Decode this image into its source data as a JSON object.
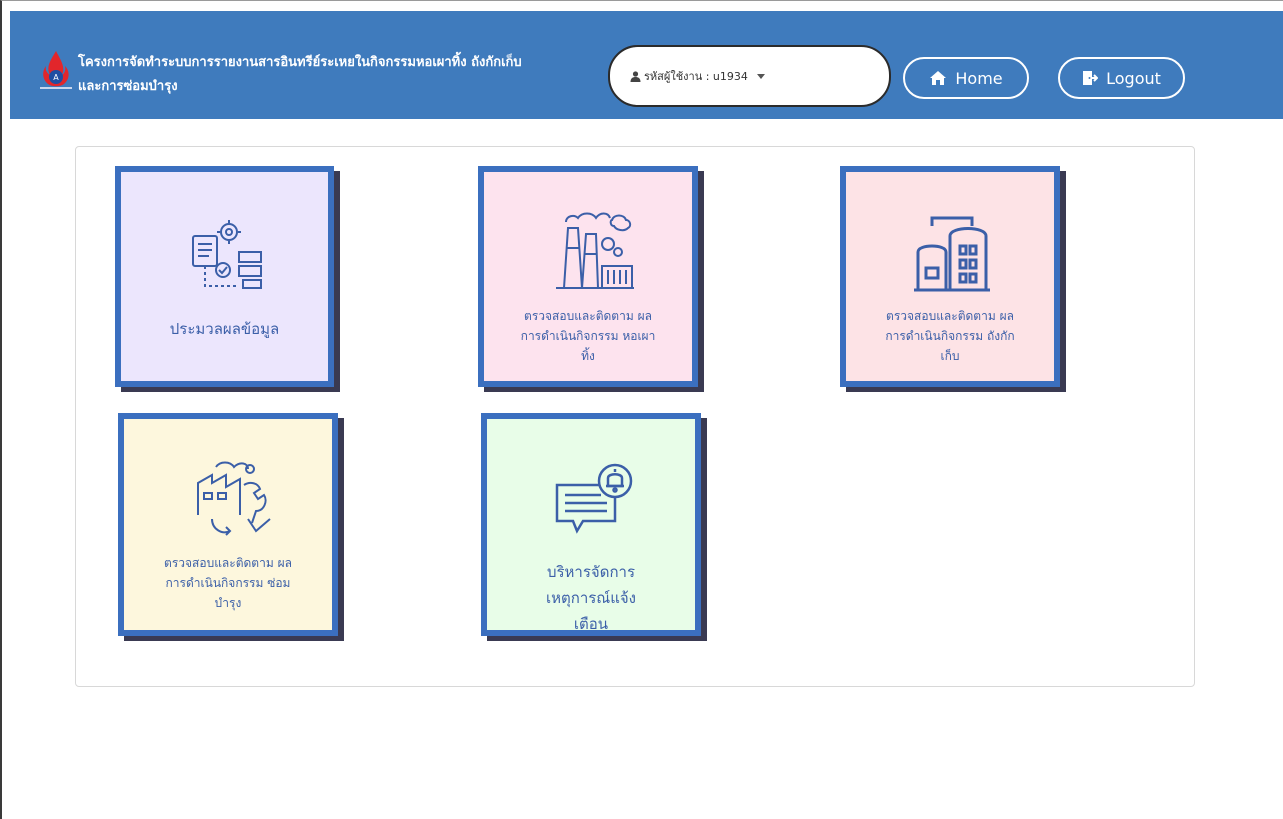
{
  "header": {
    "title": "โครงการจัดทำระบบการรายงานสารอินทรีย์ระเหยในกิจกรรมหอเผาทิ้ง ถังกักเก็บ และการซ่อมบำรุง",
    "logo_icon": "flame-logo-icon",
    "user_label": "รหัสผู้ใช้งาน : u1934",
    "home_label": "Home",
    "logout_label": "Logout",
    "bg_color": "#3f7bbd"
  },
  "cards": [
    {
      "label": "ประมวลผลข้อมูล",
      "icon": "data-process-gear-icon",
      "bg": "#ece6fd"
    },
    {
      "label": "ตรวจสอบและติดตาม ผลการดำเนินกิจกรรม หอเผาทิ้ง",
      "icon": "factory-chimney-icon",
      "bg": "#fde3ee"
    },
    {
      "label": "ตรวจสอบและติดตาม ผลการดำเนินกิจกรรม ถังกักเก็บ",
      "icon": "storage-tank-icon",
      "bg": "#fde3e6"
    },
    {
      "label": "ตรวจสอบและติดตาม ผลการดำเนินกิจกรรม ซ่อมบำรุง",
      "icon": "factory-maintenance-wrench-icon",
      "bg": "#fdf7dd"
    },
    {
      "label": "บริหารจัดการ เหตุการณ์แจ้งเตือน",
      "icon": "alert-bell-message-icon",
      "bg": "#e8fde8"
    }
  ]
}
